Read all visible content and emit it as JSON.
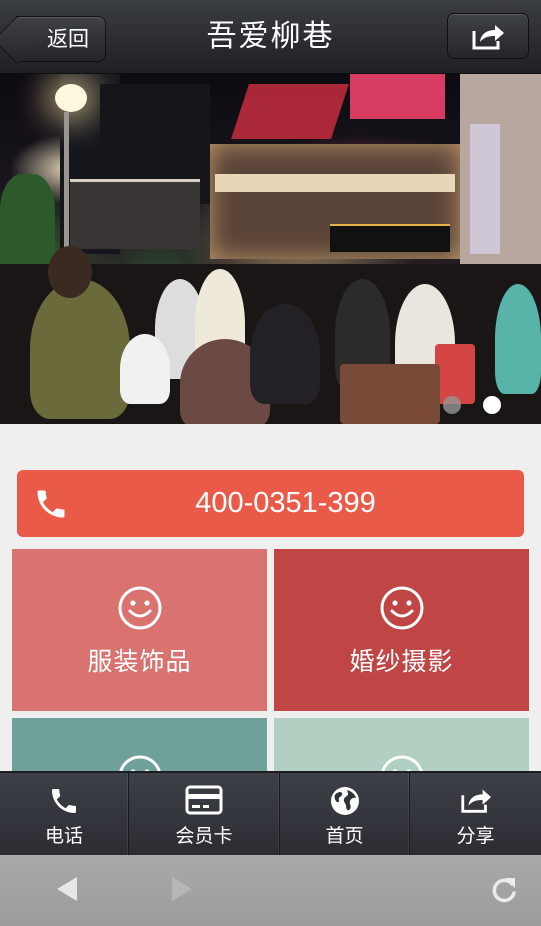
{
  "header": {
    "back_label": "返回",
    "title": "吾爱柳巷",
    "share_icon": "share-icon"
  },
  "banner": {
    "slide_count": 2,
    "active_slide": 2
  },
  "phone": {
    "number": "400-0351-399",
    "icon": "phone-icon",
    "color": "#e95b48"
  },
  "tiles": [
    {
      "label": "服装饰品",
      "icon": "smiley-icon",
      "color": "#d9736f"
    },
    {
      "label": "婚纱摄影",
      "icon": "smiley-icon",
      "color": "#c04545"
    },
    {
      "label": "",
      "icon": "smiley-icon",
      "color": "#6fa19a"
    },
    {
      "label": "",
      "icon": "smiley-icon",
      "color": "#b1d0c2"
    }
  ],
  "bottom_nav": {
    "items": [
      {
        "label": "电话",
        "icon": "phone-icon"
      },
      {
        "label": "会员卡",
        "icon": "card-icon"
      },
      {
        "label": "首页",
        "icon": "globe-icon"
      },
      {
        "label": "分享",
        "icon": "share-icon"
      }
    ]
  },
  "browser": {
    "back_icon": "triangle-left-icon",
    "forward_icon": "triangle-right-icon",
    "refresh_icon": "refresh-icon"
  }
}
